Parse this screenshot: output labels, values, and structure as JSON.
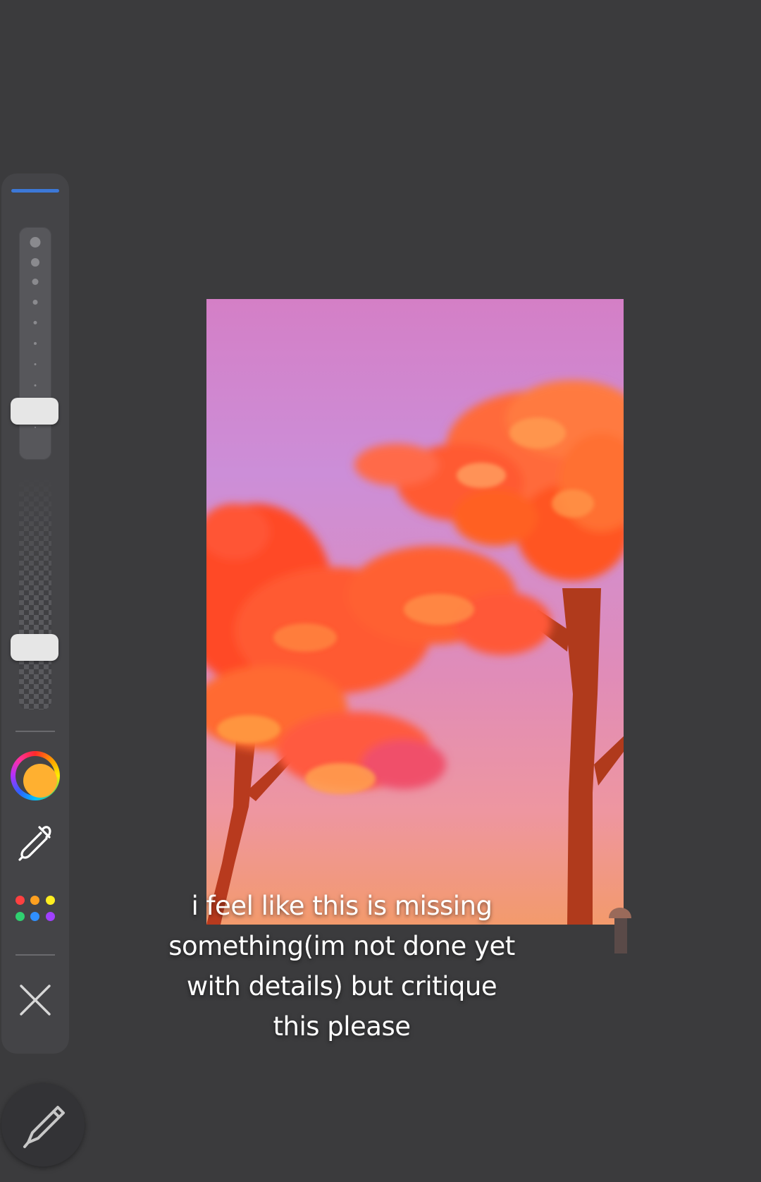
{
  "caption": {
    "text": "i feel like this is missing\nsomething(im not done yet\nwith details) but critique\nthis please"
  },
  "sidebar": {
    "accent_color": "#3c78d8",
    "brush_size_level": 0.17,
    "brush_opacity_level": 0.28,
    "current_color": "#ffb030",
    "palette_colors": [
      "#ff4040",
      "#ffa020",
      "#ffee20",
      "#30d070",
      "#3090ff",
      "#a040ff"
    ],
    "icons": [
      "color-wheel-icon",
      "eyedropper-icon",
      "palette-dots-icon",
      "close-icon",
      "pencil-icon"
    ]
  },
  "artwork": {
    "sky_colors": [
      "#d47fc6",
      "#cc8ed8",
      "#e88aa8",
      "#f19a72"
    ],
    "foliage_colors": [
      "#ff5a1a",
      "#ff7a30",
      "#ff9a50",
      "#f0506a"
    ],
    "trunk_color": "#b83a1e"
  }
}
